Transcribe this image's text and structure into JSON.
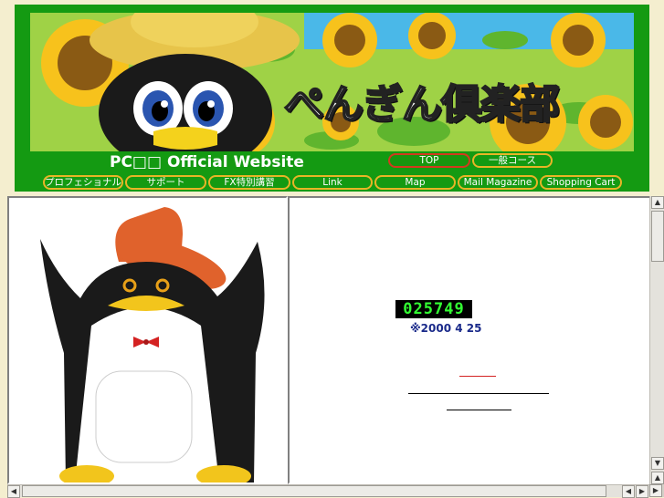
{
  "header": {
    "banner_title": "ぺんぎん倶楽部",
    "site_title": "PC□□ Official Website"
  },
  "nav": {
    "top": "TOP",
    "general": "一般コース",
    "professional": "プロフェショナル",
    "support": "サポート",
    "fx": "FX特別講習",
    "link": "Link",
    "map": "Map",
    "mail_magazine": "Mail Magazine",
    "shopping_cart": "Shopping Cart"
  },
  "content": {
    "counter": "025749",
    "since": "※2000  4  25"
  },
  "colors": {
    "header_green": "#149a12",
    "nav_border": "#e8b526",
    "nav_active_border": "#d23a1e",
    "page_bg": "#f4eecf",
    "counter_digits": "#33ff33",
    "hat": "#e0622c"
  },
  "icons": {
    "scroll_up": "▲",
    "scroll_down": "▼",
    "scroll_left": "◀",
    "scroll_right": "▶"
  }
}
